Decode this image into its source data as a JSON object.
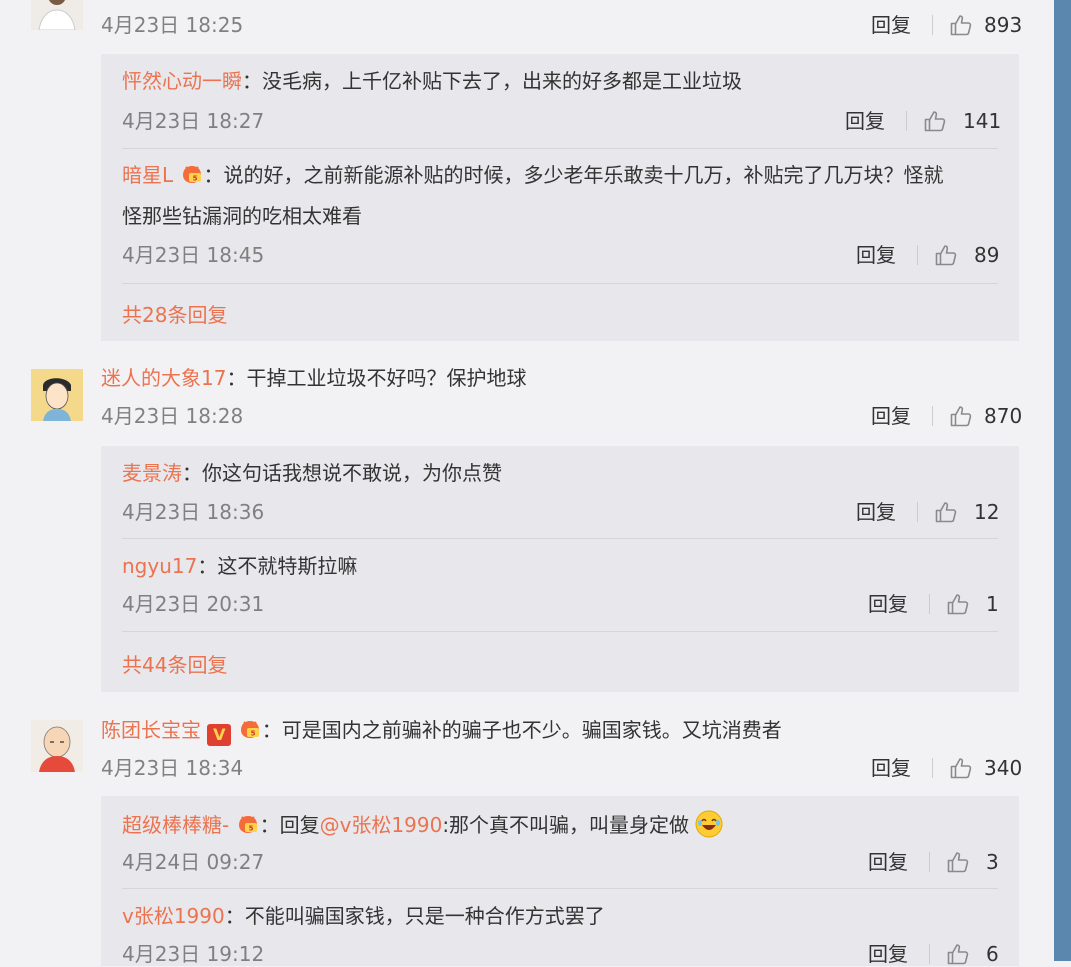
{
  "colors": {
    "username": "#eb7350",
    "text": "#333333",
    "meta": "#808080",
    "subbox": "#e8e8ec",
    "scrollbar": "#5b86ae"
  },
  "c1": {
    "time": "4月23日 18:25",
    "reply": "回复",
    "likes": "893",
    "subs": [
      {
        "user": "怦然心动一瞬",
        "text": "：没毛病，上千亿补贴下去了，出来的好多都是工业垃圾",
        "time": "4月23日 18:27",
        "reply": "回复",
        "likes": "141"
      },
      {
        "user": "暗星L",
        "text": "：说的好，之前新能源补贴的时候，多少老年乐敢卖十几万，补贴完了几万块？怪就",
        "text2": "怪那些钻漏洞的吃相太难看",
        "time": "4月23日 18:45",
        "reply": "回复",
        "likes": "89"
      }
    ],
    "more": "共28条回复"
  },
  "c2": {
    "user": "迷人的大象17",
    "text": "：干掉工业垃圾不好吗？保护地球",
    "time": "4月23日 18:28",
    "reply": "回复",
    "likes": "870",
    "subs": [
      {
        "user": "麦景涛",
        "text": "：你这句话我想说不敢说，为你点赞",
        "time": "4月23日 18:36",
        "reply": "回复",
        "likes": "12"
      },
      {
        "user": "ngyu17",
        "text": "：这不就特斯拉嘛",
        "time": "4月23日 20:31",
        "reply": "回复",
        "likes": "1"
      }
    ],
    "more": "共44条回复"
  },
  "c3": {
    "user": "陈团长宝宝",
    "v_badge": "V",
    "text": "：可是国内之前骗补的骗子也不少。骗国家钱。又坑消费者",
    "time": "4月23日 18:34",
    "reply": "回复",
    "likes": "340",
    "subs": [
      {
        "user": "超级棒棒糖-",
        "text_pre": "：回复",
        "mention": "@v张松1990",
        "text": ":那个真不叫骗，叫量身定做",
        "time": "4月24日 09:27",
        "reply": "回复",
        "likes": "3"
      },
      {
        "user": "v张松1990",
        "text": "：不能叫骗国家钱，只是一种合作方式罢了",
        "time": "4月23日 19:12",
        "reply": "回复",
        "likes": "6"
      }
    ]
  }
}
